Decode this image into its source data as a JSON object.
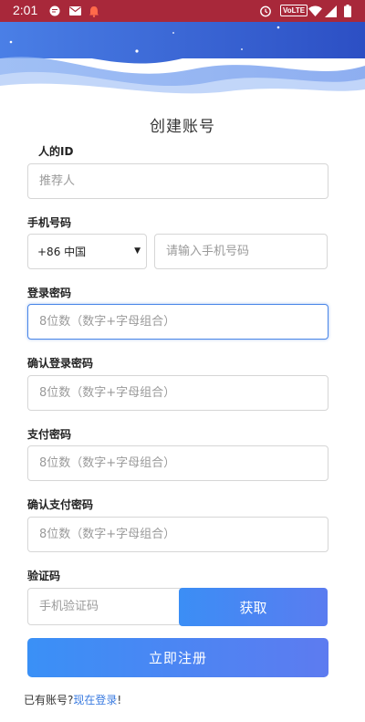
{
  "status_bar": {
    "time": "2:01",
    "volte": "VoLTE"
  },
  "page": {
    "title": "创建账号"
  },
  "referrer": {
    "label": "人的ID",
    "placeholder": "推荐人"
  },
  "phone": {
    "label": "手机号码",
    "country_code": "+86 中国",
    "placeholder": "请输入手机号码"
  },
  "login_password": {
    "label": "登录密码",
    "placeholder": "8位数（数字+字母组合）"
  },
  "confirm_login_password": {
    "label": "确认登录密码",
    "placeholder": "8位数（数字+字母组合）"
  },
  "pay_password": {
    "label": "支付密码",
    "placeholder": "8位数（数字+字母组合）"
  },
  "confirm_pay_password": {
    "label": "确认支付密码",
    "placeholder": "8位数（数字+字母组合）"
  },
  "verify": {
    "label": "验证码",
    "placeholder": "手机验证码",
    "get_button": "获取"
  },
  "register_button": "立即注册",
  "login_prompt": {
    "text": "已有账号?",
    "link": "现在登录",
    "suffix": "!"
  },
  "colors": {
    "status_bar": "#a8283a",
    "accent": "#4a86e8",
    "button": "#3b8ef5"
  },
  "icons": [
    "message-icon",
    "mail-icon",
    "notification-icon",
    "alarm-icon",
    "wifi-icon",
    "signal-icon",
    "battery-icon",
    "dropdown-caret-icon"
  ]
}
